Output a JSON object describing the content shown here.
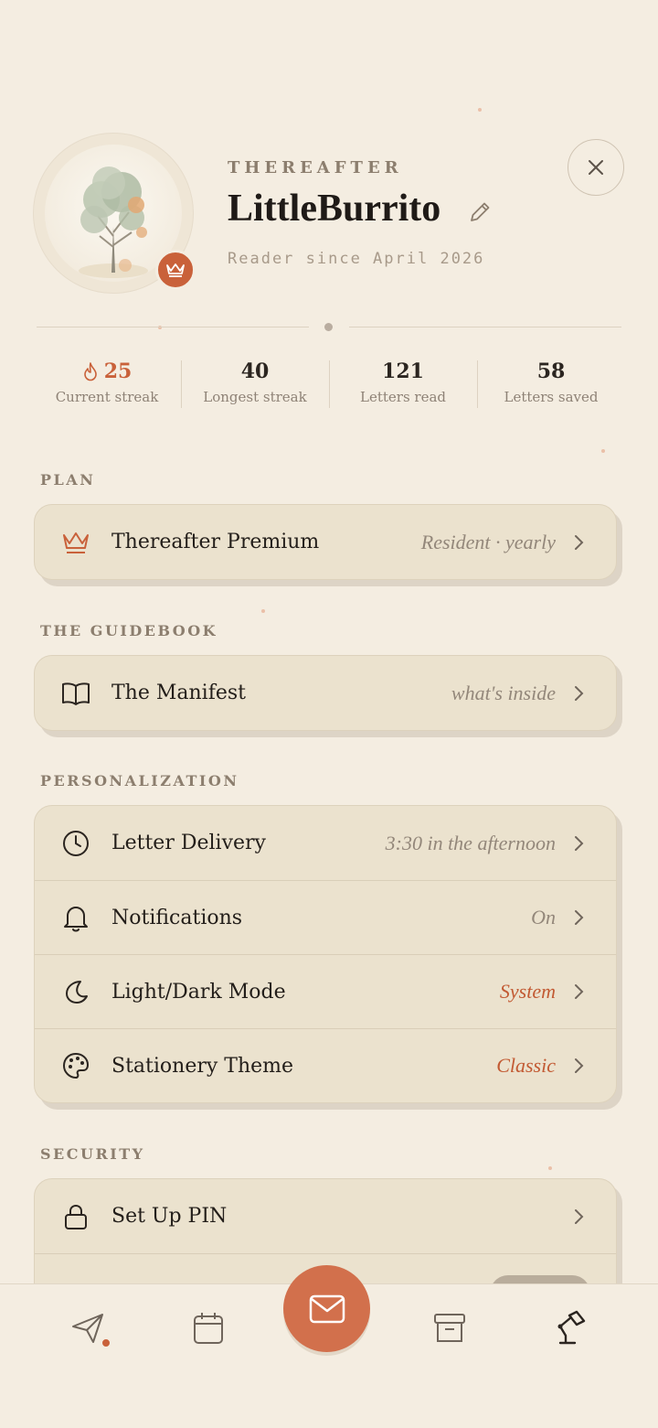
{
  "header": {
    "brand": "THEREAFTER",
    "username": "LittleBurrito",
    "since": "Reader since April 2026"
  },
  "stats": [
    {
      "value": "25",
      "label": "Current streak",
      "icon": "flame-icon"
    },
    {
      "value": "40",
      "label": "Longest streak"
    },
    {
      "value": "121",
      "label": "Letters read"
    },
    {
      "value": "58",
      "label": "Letters saved"
    }
  ],
  "plan": {
    "section": "PLAN",
    "label": "Thereafter Premium",
    "value": "Resident · yearly"
  },
  "guidebook": {
    "section": "THE GUIDEBOOK",
    "label": "The Manifest",
    "value": "what's inside"
  },
  "personalization": {
    "section": "PERSONALIZATION",
    "items": [
      {
        "label": "Letter Delivery",
        "value": "3:30 in the afternoon",
        "icon": "clock-icon"
      },
      {
        "label": "Notifications",
        "value": "On",
        "icon": "bell-icon"
      },
      {
        "label": "Light/Dark Mode",
        "value": "System",
        "icon": "moon-icon"
      },
      {
        "label": "Stationery Theme",
        "value": "Classic",
        "icon": "palette-icon"
      }
    ]
  },
  "security": {
    "section": "SECURITY",
    "pin_label": "Set Up PIN"
  },
  "colors": {
    "accent": "#c9613a",
    "background": "#f4ede1",
    "card": "#ebe2ce"
  }
}
